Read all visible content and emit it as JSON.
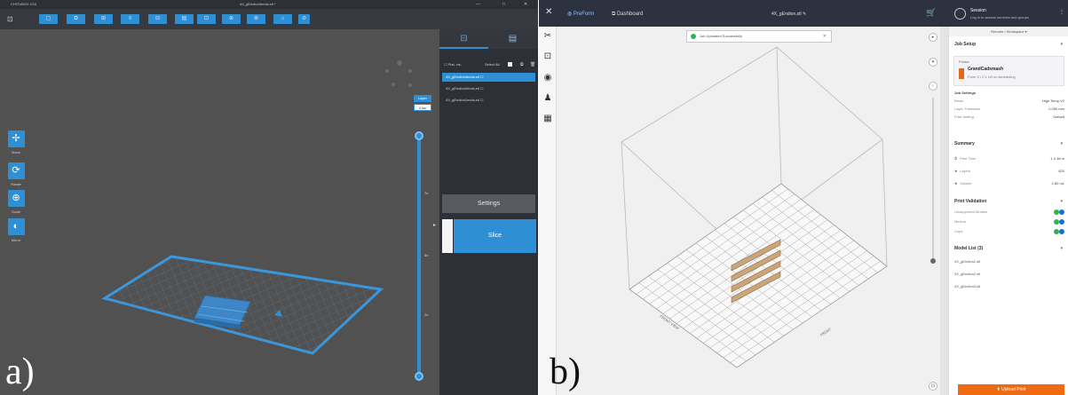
{
  "panel_a": {
    "letter": "a)",
    "title": "CHITUBOX V16",
    "filename": "4X_gEndion3ends.stl *",
    "window_controls": [
      "—",
      "□",
      "✕"
    ],
    "toolbar_buttons": [
      "▢",
      "⧉",
      "⊞",
      "≡",
      "⊟",
      "▤",
      "⊡",
      "⊕",
      "⊗",
      "⌂",
      "⊘"
    ],
    "left_tools": [
      {
        "icon": "move-icon",
        "glyph": "✢",
        "label": "Move"
      },
      {
        "icon": "rotate-icon",
        "glyph": "⟳",
        "label": "Rotate"
      },
      {
        "icon": "scale-icon",
        "glyph": "⊕",
        "label": "Scale"
      },
      {
        "icon": "mirror-icon",
        "glyph": "◐",
        "label": "Mirror"
      }
    ],
    "layer_slider": {
      "top_label": "Layer",
      "top_value": "4 Inc",
      "ticks": [
        "7x",
        "5x",
        "2x"
      ],
      "position": 1.0
    },
    "tabs": [
      {
        "icon": "model-list-icon",
        "glyph": "⊟"
      },
      {
        "icon": "settings-icon",
        "glyph": "▤"
      }
    ],
    "list_header": {
      "checkbox": "☐",
      "label": "Plat. vis.",
      "select": "Select All"
    },
    "models": [
      "4X_gEndion3ends.stl ☐",
      "4X_gEndion2ends.stl ☐",
      "4X_gEndion1ends.stl ☐"
    ],
    "setup_label": "Settings",
    "slice_label": "Slice",
    "edge_arrow": "▸"
  },
  "panel_b": {
    "letter": "b)",
    "nav": [
      {
        "icon": "preform-logo-icon",
        "glyph": "✕"
      },
      {
        "label": "PreForm",
        "active": true
      },
      {
        "label": "Dashboard",
        "active": false
      }
    ],
    "filename": "4X_gEndion.stl ✎",
    "cart_glyph": "🛒",
    "session": {
      "name": "Session",
      "desc": "Log in to access services and groups"
    },
    "left_tools": [
      "✂",
      "⊡",
      "◉",
      "♟",
      "▦"
    ],
    "notification": "Job Uploaded Successfully",
    "notification_close": "✕",
    "right_controls": [
      "▸",
      "▾",
      "‹",
      "⊡"
    ],
    "workspace_select": "Remote / Workspace ▾",
    "job_setup": {
      "heading": "Job Setup",
      "collapse": "▾",
      "printer_heading": "Printer",
      "printer_name": "GrandCadsmash",
      "printer_desc": "Form 2 • 0.1 LB no scheduling",
      "settings_heading": "Job Settings",
      "settings": [
        {
          "k": "Resin",
          "v": "High Temp V2"
        },
        {
          "k": "Layer Thickness",
          "v": "0.050 mm"
        },
        {
          "k": "Print Setting",
          "v": "Default"
        }
      ]
    },
    "summary": {
      "heading": "Summary",
      "rows": [
        {
          "icon": "clock-icon",
          "glyph": "⏱",
          "k": "Print Time",
          "v": "1 h 38 m"
        },
        {
          "icon": "layers-icon",
          "glyph": "★",
          "k": "Layers",
          "v": "820"
        },
        {
          "icon": "volume-icon",
          "glyph": "★",
          "k": "Volume",
          "v": "2.80 mL"
        }
      ]
    },
    "validation": {
      "heading": "Print Validation",
      "rows": [
        "Unsupported Models",
        "Minima",
        "Cups"
      ]
    },
    "model_list": {
      "heading": "Model List (3)",
      "items": [
        "4X_gEndion1.stl",
        "4X_gEndion2.stl",
        "4X_gEndion3.stl"
      ]
    },
    "upload_label": "⬆ Upload Print",
    "plate_labels": [
      "FRONT VIEW",
      "FRONT"
    ]
  },
  "colors": {
    "chitubox_blue": "#2f8fd4",
    "preform_topbar": "#2d3240",
    "upload_orange": "#f06a12",
    "part_tan": "#c8a57a"
  }
}
